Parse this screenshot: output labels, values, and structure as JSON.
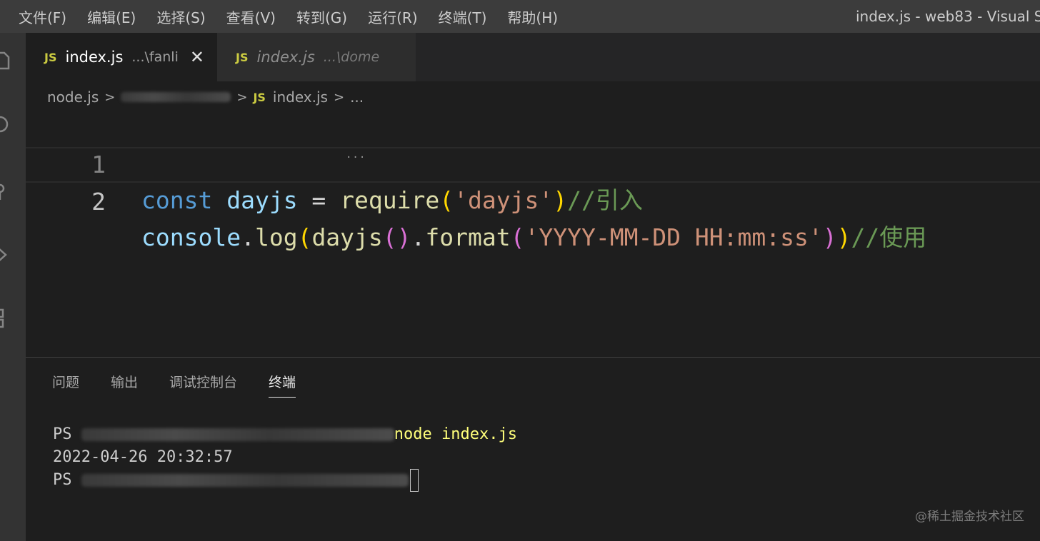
{
  "menu": [
    "文件(F)",
    "编辑(E)",
    "选择(S)",
    "查看(V)",
    "转到(G)",
    "运行(R)",
    "终端(T)",
    "帮助(H)"
  ],
  "window_title": "index.js - web83 - Visual S",
  "tabs": [
    {
      "badge": "JS",
      "name": "index.js",
      "path": "...\\fanli",
      "close": "✕"
    },
    {
      "badge": "JS",
      "name": "index.js",
      "path": "...\\dome"
    }
  ],
  "breadcrumb": {
    "root": "node.js",
    "sep": ">",
    "badge": "JS",
    "file": "index.js",
    "more": "..."
  },
  "editor": {
    "line_numbers": [
      "1",
      "2"
    ],
    "line1": {
      "kw": "const",
      "var": "dayjs",
      "op": " = ",
      "fn": "require",
      "open": "(",
      "str": "'dayjs'",
      "close": ")",
      "comment": "//引入"
    },
    "line2": {
      "obj": "console",
      "dot": ".",
      "method": "log",
      "open1": "(",
      "fn": "dayjs",
      "call": "()",
      "dot2": ".",
      "method2": "format",
      "open2": "(",
      "str": "'YYYY-MM-DD HH:mm:ss'",
      "close2": ")",
      "close1": ")",
      "comment": "//使用"
    },
    "hint_dots": "..."
  },
  "panel": {
    "tabs": [
      "问题",
      "输出",
      "调试控制台",
      "终端"
    ],
    "active_tab": "终端",
    "terminal": {
      "prompt1": "PS ",
      "command": "node index.js",
      "output": "2022-04-26 20:32:57",
      "prompt2": "PS "
    }
  },
  "watermark": "@稀土掘金技术社区"
}
